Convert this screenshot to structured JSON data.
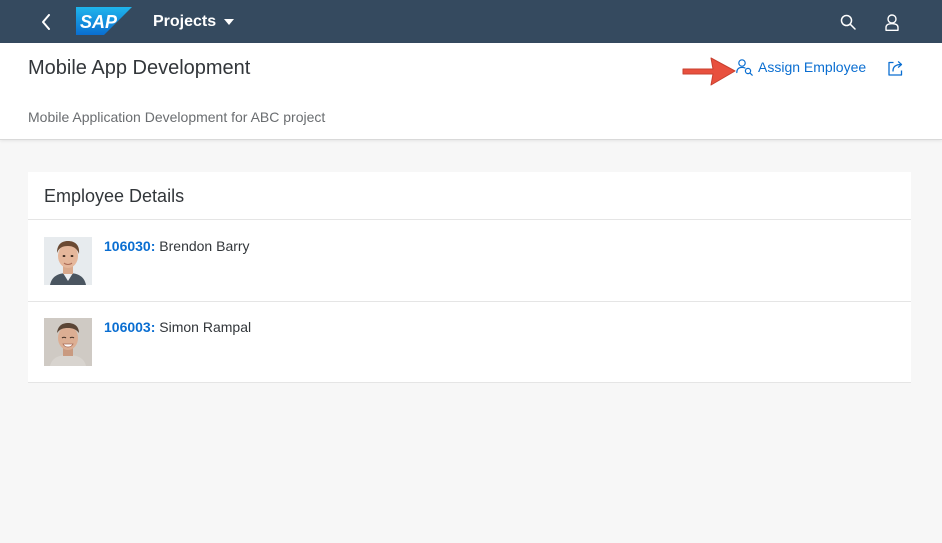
{
  "shell": {
    "logo_text": "SAP",
    "app_title": "Projects",
    "back_icon": "chevron-left-icon",
    "search_icon": "search-icon",
    "user_icon": "user-icon",
    "bar_color": "#354a5f"
  },
  "header": {
    "title": "Mobile App Development",
    "subtitle": "Mobile Application Development for ABC project",
    "assign_label": "Assign Employee",
    "assign_icon": "person-search-icon",
    "share_icon": "share-icon",
    "link_color": "#0a6ed1"
  },
  "employees": {
    "title": "Employee Details",
    "rows": [
      {
        "id": "106030:",
        "name": "Brendon Barry"
      },
      {
        "id": "106003:",
        "name": "Simon Rampal"
      }
    ]
  },
  "annotation": {
    "arrow_color": "#e8503e"
  }
}
